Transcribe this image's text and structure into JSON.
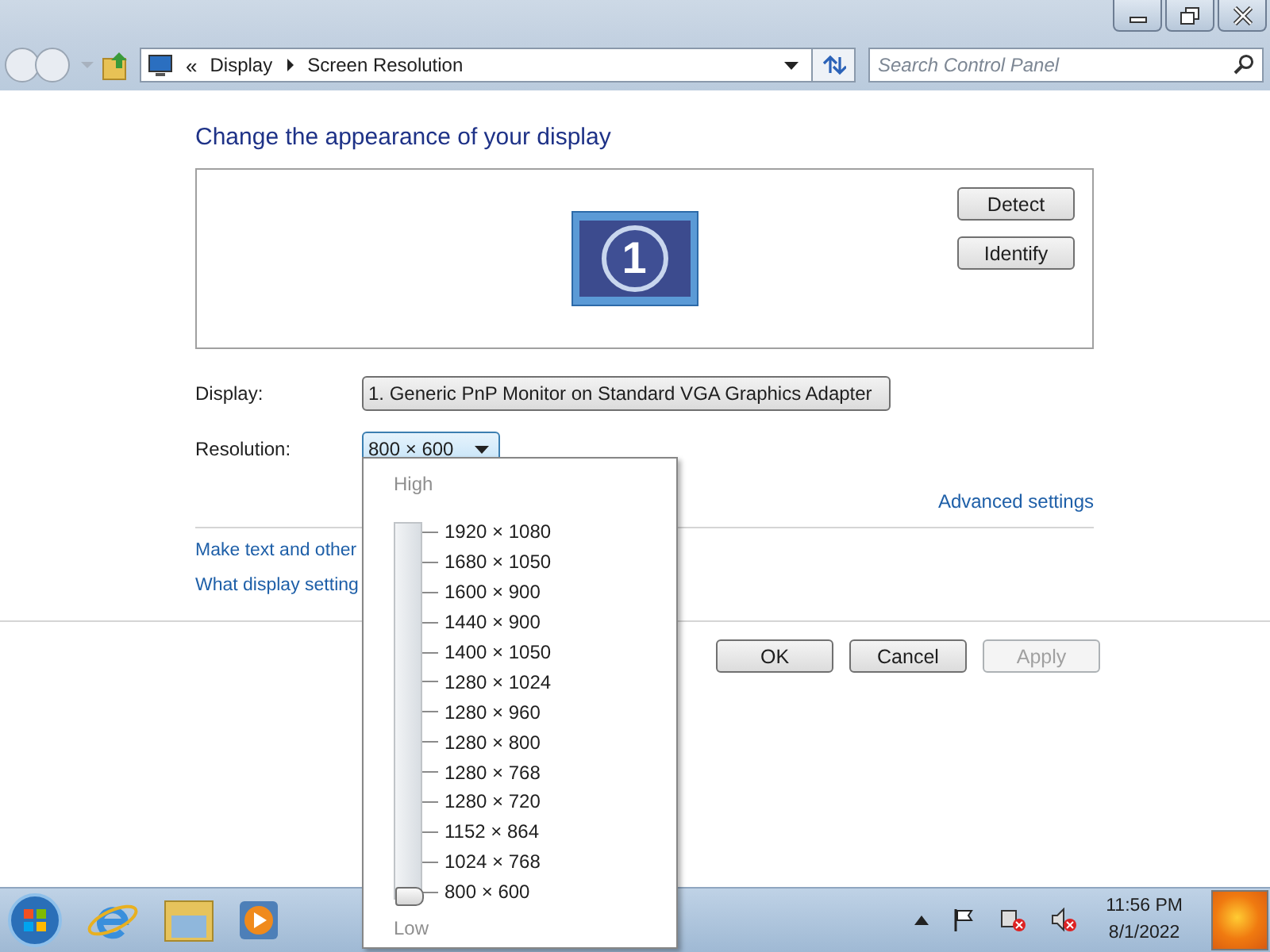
{
  "address_bar": {
    "separator": "«",
    "crumbs": [
      "Display",
      "Screen Resolution"
    ]
  },
  "search": {
    "placeholder": "Search Control Panel"
  },
  "heading": "Change the appearance of your display",
  "monitor": {
    "number": "1"
  },
  "side_buttons": [
    "Detect",
    "Identify"
  ],
  "display": {
    "label": "Display:",
    "value": "1. Generic PnP Monitor on Standard VGA Graphics Adapter"
  },
  "resolution": {
    "label": "Resolution:",
    "value": "800 × 600",
    "expanded": true
  },
  "resolution_popup": {
    "high": "High",
    "low": "Low",
    "level": 0,
    "options": [
      "1920 × 1080",
      "1680 × 1050",
      "1600 × 900",
      "1440 × 900",
      "1400 × 1050",
      "1280 × 1024",
      "1280 × 960",
      "1280 × 800",
      "1280 × 768",
      "1280 × 720",
      "1152 × 864",
      "1024 × 768",
      "800 × 600"
    ]
  },
  "advanced_link": "Advanced settings",
  "links": [
    "Make text and other",
    "What display setting"
  ],
  "buttons": [
    {
      "label": "OK",
      "disabled": false
    },
    {
      "label": "Cancel",
      "disabled": false
    },
    {
      "label": "Apply",
      "disabled": true
    }
  ],
  "taskbar": {
    "time": "11:56 PM",
    "date": "8/1/2022"
  }
}
